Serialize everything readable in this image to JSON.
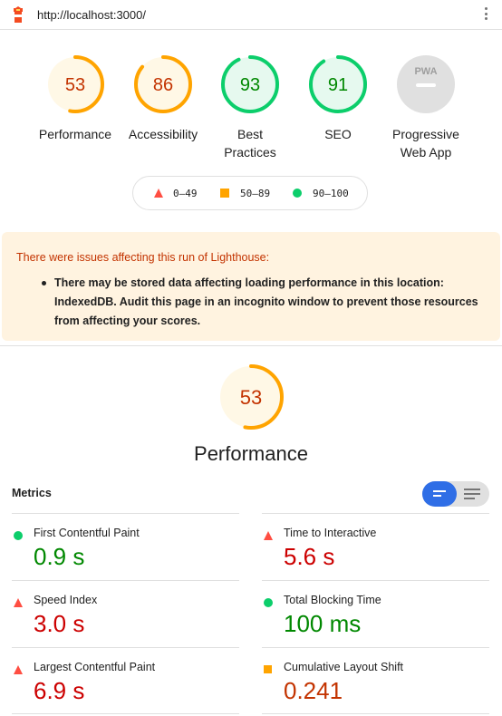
{
  "browser": {
    "url": "http://localhost:3000/"
  },
  "colors": {
    "pass": "#0cce6b",
    "average": "#ffa400",
    "fail": "#ff4e42",
    "pass_text": "#008800",
    "average_text": "#c33300",
    "fail_text": "#cc0000",
    "na": "#e0e0e0",
    "accent": "#2f6ee6"
  },
  "categories": [
    {
      "label": "Performance",
      "score": "53",
      "level": "average"
    },
    {
      "label": "Accessibility",
      "score": "86",
      "level": "average"
    },
    {
      "label": "Best Practices",
      "score": "93",
      "level": "pass"
    },
    {
      "label": "SEO",
      "score": "91",
      "level": "pass"
    },
    {
      "label": "Progressive Web App",
      "score": "",
      "badge": "PWA",
      "level": "na"
    }
  ],
  "legend": {
    "fail": "0–49",
    "average": "50–89",
    "pass": "90–100"
  },
  "warning": {
    "title": "There were issues affecting this run of Lighthouse:",
    "items": [
      "There may be stored data affecting loading performance in this location: IndexedDB. Audit this page in an incognito window to prevent those resources from affecting your scores."
    ]
  },
  "performance": {
    "score": "53",
    "title": "Performance",
    "metrics_title": "Metrics",
    "metrics": [
      {
        "name": "First Contentful Paint",
        "value": "0.9 s",
        "level": "pass"
      },
      {
        "name": "Time to Interactive",
        "value": "5.6 s",
        "level": "fail"
      },
      {
        "name": "Speed Index",
        "value": "3.0 s",
        "level": "fail"
      },
      {
        "name": "Total Blocking Time",
        "value": "100 ms",
        "level": "pass"
      },
      {
        "name": "Largest Contentful Paint",
        "value": "6.9 s",
        "level": "fail"
      },
      {
        "name": "Cumulative Layout Shift",
        "value": "0.241",
        "level": "average"
      }
    ]
  }
}
